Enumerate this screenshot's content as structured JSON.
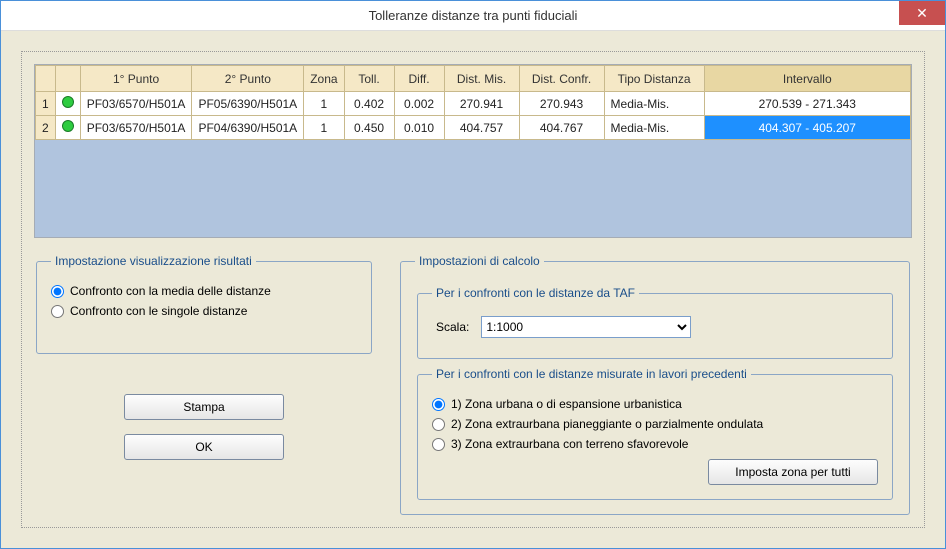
{
  "window": {
    "title": "Tolleranze distanze tra punti fiduciali"
  },
  "grid": {
    "headers": [
      "",
      "",
      "1° Punto",
      "2° Punto",
      "Zona",
      "Toll.",
      "Diff.",
      "Dist. Mis.",
      "Dist. Confr.",
      "Tipo Distanza",
      "Intervallo"
    ],
    "rows": [
      {
        "n": "1",
        "p1": "PF03/6570/H501A",
        "p2": "PF05/6390/H501A",
        "zona": "1",
        "toll": "0.402",
        "diff": "0.002",
        "mis": "270.941",
        "confr": "270.943",
        "tipo": "Media-Mis.",
        "intervallo": "270.539 - 271.343"
      },
      {
        "n": "2",
        "p1": "PF03/6570/H501A",
        "p2": "PF04/6390/H501A",
        "zona": "1",
        "toll": "0.450",
        "diff": "0.010",
        "mis": "404.757",
        "confr": "404.767",
        "tipo": "Media-Mis.",
        "intervallo": "404.307 - 405.207"
      }
    ]
  },
  "viz": {
    "legend": "Impostazione visualizzazione risultati",
    "opt_media": "Confronto con la media delle distanze",
    "opt_singole": "Confronto con le singole distanze"
  },
  "buttons": {
    "stampa": "Stampa",
    "ok": "OK"
  },
  "calc": {
    "legend": "Impostazioni di calcolo",
    "taf_legend": "Per i confronti con le distanze da TAF",
    "scala_label": "Scala:",
    "scala_value": "1:1000",
    "prec_legend": "Per i confronti con le distanze misurate in lavori precedenti",
    "zona1": "1) Zona urbana o di espansione urbanistica",
    "zona2": "2) Zona extraurbana pianeggiante o parzialmente ondulata",
    "zona3": "3) Zona extraurbana con terreno sfavorevole",
    "imposta": "Imposta zona per tutti"
  }
}
